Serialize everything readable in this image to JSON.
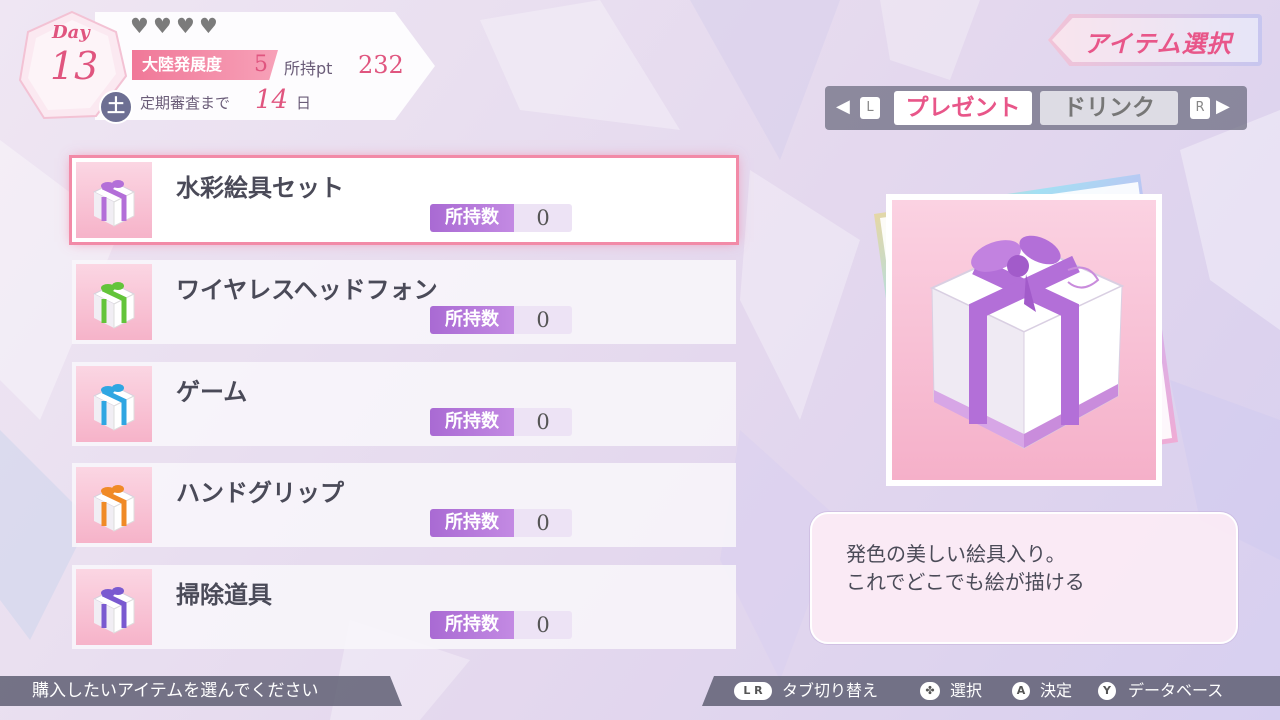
{
  "status": {
    "day_label": "Day",
    "day_number": "13",
    "hearts": [
      "heart",
      "heart",
      "heart",
      "heart"
    ],
    "development_label": "大陸発展度",
    "development_value": "5",
    "points_label": "所持pt",
    "points_value": "232",
    "weekday": "土",
    "review_label": "定期審査まで",
    "review_days": "14",
    "review_unit": "日"
  },
  "header": {
    "title": "アイテム選択"
  },
  "tabs": {
    "left_key": "L",
    "right_key": "R",
    "items": [
      {
        "label": "プレゼント",
        "active": true
      },
      {
        "label": "ドリンク",
        "active": false
      }
    ]
  },
  "items": [
    {
      "name": "水彩絵具セット",
      "owned_label": "所持数",
      "owned_count": "0",
      "ribbon_color": "#b36fd8",
      "selected": true
    },
    {
      "name": "ワイヤレスヘッドフォン",
      "owned_label": "所持数",
      "owned_count": "0",
      "ribbon_color": "#63c43a",
      "selected": false
    },
    {
      "name": "ゲーム",
      "owned_label": "所持数",
      "owned_count": "0",
      "ribbon_color": "#2fa6e2",
      "selected": false
    },
    {
      "name": "ハンドグリップ",
      "owned_label": "所持数",
      "owned_count": "0",
      "ribbon_color": "#f08a26",
      "selected": false
    },
    {
      "name": "掃除道具",
      "owned_label": "所持数",
      "owned_count": "0",
      "ribbon_color": "#7a5ad0",
      "selected": false
    }
  ],
  "preview": {
    "ribbon_color": "#b36fd8"
  },
  "description": {
    "line1": "発色の美しい絵具入り。",
    "line2": "これでどこでも絵が描ける"
  },
  "footer": {
    "instruction": "購入したいアイテムを選んでください",
    "hints": [
      {
        "key": "L R",
        "label": "タブ切り替え"
      },
      {
        "key": "✤",
        "label": "選択"
      },
      {
        "key": "A",
        "label": "決定"
      },
      {
        "key": "Y",
        "label": "データベース"
      }
    ]
  },
  "colors": {
    "accent_pink": "#e85689",
    "badge_purple": "#a96ad3",
    "panel_gray": "#5f5f73"
  }
}
